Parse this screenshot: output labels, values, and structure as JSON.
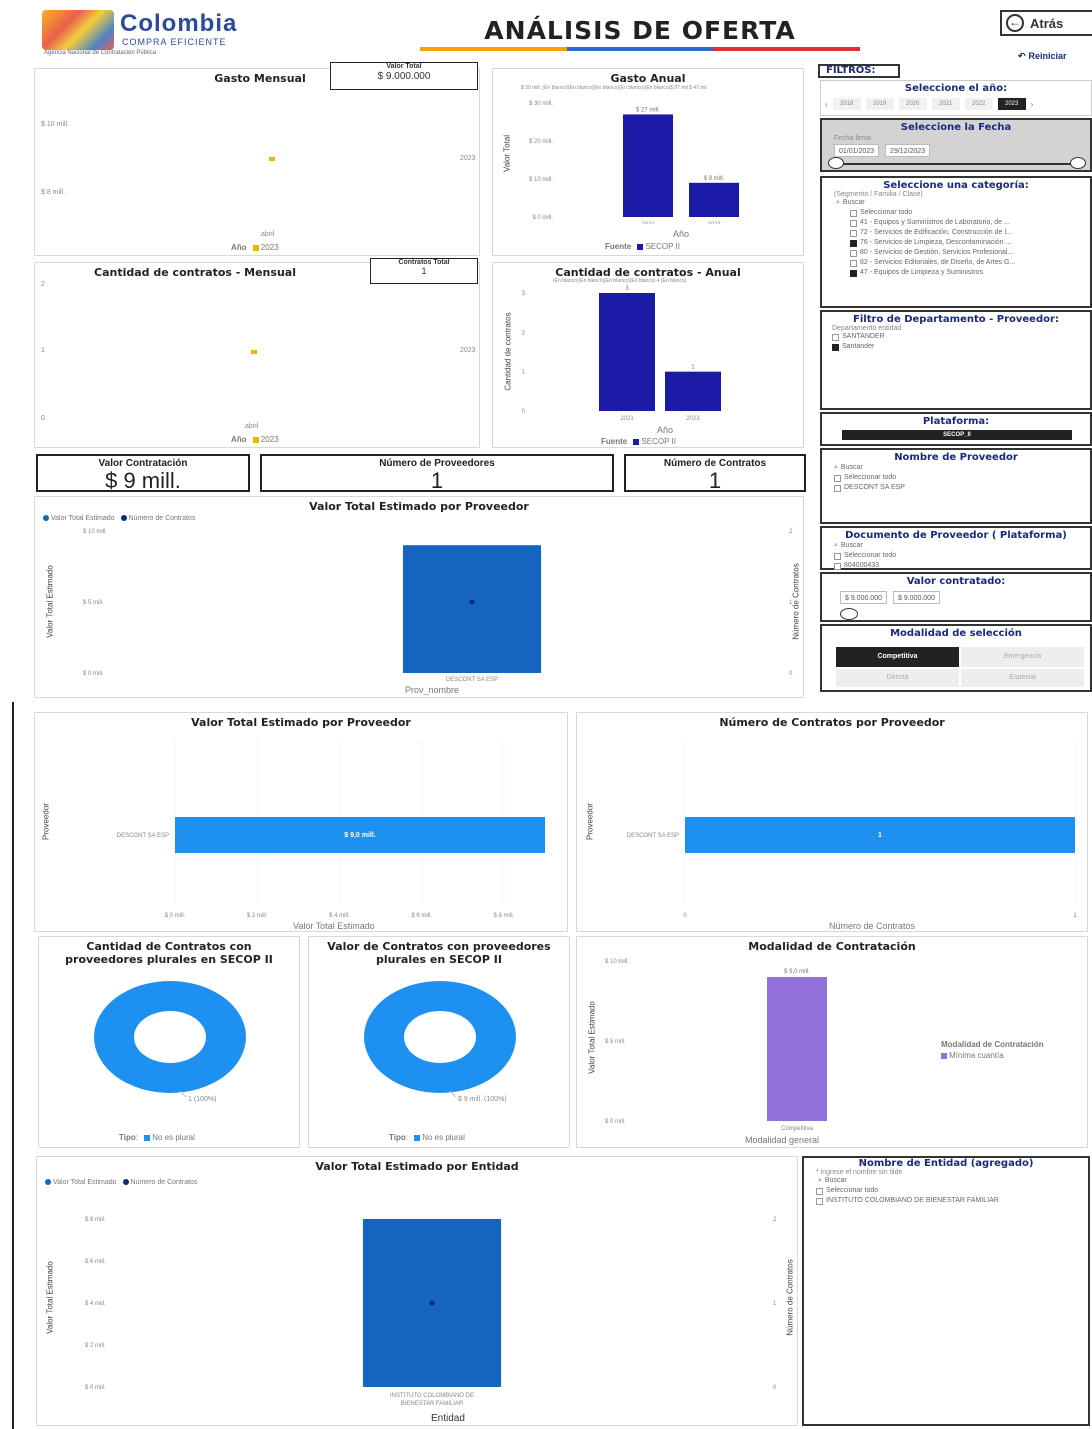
{
  "header": {
    "logo_name": "Colombia",
    "logo_sub": "COMPRA EFICIENTE",
    "logo_tag": "Agencia Nacional de Contratación Pública",
    "title": "ANÁLISIS DE OFERTA",
    "back_label": "Atrás",
    "reset_label": "Reiniciar"
  },
  "kpis": {
    "valor_total_label": "Valor Total",
    "valor_total": "$ 9.000.000",
    "contratos_total_label": "Contratos Total",
    "contratos_total": "1",
    "valor_contratacion_label": "Valor Contratación",
    "valor_contratacion": "$ 9 mill.",
    "num_proveedores_label": "Número de Proveedores",
    "num_proveedores": "1",
    "num_contratos_label": "Número de Contratos",
    "num_contratos": "1"
  },
  "gasto_mensual": {
    "title": "Gasto Mensual",
    "ticks": [
      "$ 10 mill.",
      "$ 8 mill."
    ],
    "right_label": "2023",
    "x_label": "abril",
    "legend_title": "Año",
    "legend_item": "2023",
    "color": "#e6b800"
  },
  "cantidad_mensual": {
    "title": "Cantidad de contratos - Mensual",
    "ticks": [
      "2",
      "1",
      "0"
    ],
    "right_label": "2023",
    "x_label": "abril",
    "legend_title": "Año",
    "legend_item": "2023",
    "color": "#e6b800"
  },
  "gasto_anual": {
    "title": "Gasto Anual",
    "top_note": "$ 30 mill.  (En blanco)(En blanco)(En blanco)(En blanco)(En blanco)$ 87 mil   $ 47 mil",
    "ylabel": "Valor Total",
    "xlabel": "Año",
    "legend_title": "Fuente",
    "legend_item": "SECOP II",
    "color": "#1a1aa6",
    "chart_data": {
      "type": "bar",
      "categories": [
        "2021",
        "2023"
      ],
      "values": [
        27,
        9
      ],
      "value_labels": [
        "$ 27 mill.",
        "$ 9 mill."
      ],
      "ticks": [
        "$ 30 mill.",
        "$ 20 mill.",
        "$ 10 mill.",
        "$ 0 mill."
      ],
      "ylim": [
        0,
        30
      ]
    }
  },
  "cantidad_anual": {
    "title": "Cantidad de contratos - Anual",
    "top_note": "(En blanco)(En blanco)(En blanco)(En blanco)     4      (En blanco)",
    "ylabel": "Cantidad de contratos",
    "xlabel": "Año",
    "legend_title": "Fuente",
    "legend_item": "SECOP II",
    "color": "#1a1aa6",
    "chart_data": {
      "type": "bar",
      "categories": [
        "2021",
        "2023"
      ],
      "values": [
        3,
        1
      ],
      "value_labels": [
        "3",
        "1"
      ],
      "ticks": [
        "3",
        "2",
        "1",
        "0"
      ],
      "ylim": [
        0,
        3
      ]
    }
  },
  "prov_combo": {
    "title": "Valor Total Estimado por Proveedor",
    "legend": [
      "Valor Total Estimado",
      "Número de Contratos"
    ],
    "left_ticks": [
      "$ 10 mill.",
      "$ 5 mill.",
      "$ 0 mill."
    ],
    "right_ticks": [
      "2",
      "1",
      "0"
    ],
    "ylabel": "Valor Total Estimado",
    "y2label": "Número de Contratos",
    "xlabel": "Prov_nombre",
    "category": "DESCONT SA ESP",
    "color": "#1565c0",
    "chart_data": {
      "type": "bar",
      "categories": [
        "DESCONT SA ESP"
      ],
      "values": [
        9
      ],
      "contracts": [
        1
      ],
      "ylim": [
        0,
        10
      ]
    }
  },
  "filters": {
    "title": "FILTROS:",
    "year_title": "Seleccione el año:",
    "years": [
      "2018",
      "2019",
      "2020",
      "2021",
      "2022",
      "2023"
    ],
    "date_title": "Seleccione la Fecha",
    "date_label": "Fecha firma",
    "date_from": "01/01/2023",
    "date_to": "29/12/2023",
    "cat_title": "Seleccione una categoría:",
    "cat_sub": "(Segmento / Familia / Clase)",
    "search": "Buscar",
    "cat_items": [
      {
        "label": "Seleccionar todo",
        "on": false
      },
      {
        "label": "41 - Equipos y Suministros de Laboratorio, de ...",
        "on": false
      },
      {
        "label": "72 - Servicios de Edificación, Construcción de I...",
        "on": false
      },
      {
        "label": "76 - Servicios de Limpieza, Descontaminación ...",
        "on": true
      },
      {
        "label": "80 - Servicios de Gestión, Servicios Profesional...",
        "on": false
      },
      {
        "label": "82 - Servicios Editoriales, de Diseño, de Artes G...",
        "on": false
      },
      {
        "label": "47 - Equipos de Limpieza y Suministros",
        "on": true
      }
    ],
    "dept_title": "Filtro de Departamento - Proveedor:",
    "dept_sub": "Departamento entidad",
    "dept_items": [
      {
        "label": "SANTANDER",
        "on": false
      },
      {
        "label": "Santander",
        "on": true
      }
    ],
    "plat_title": "Plataforma:",
    "plat_value": "SECOP_II",
    "prov_title": "Nombre de Proveedor",
    "prov_items": [
      {
        "label": "Seleccionar todo",
        "on": false
      },
      {
        "label": "DESCONT SA ESP",
        "on": false
      }
    ],
    "doc_title": "Documento de Proveedor ( Plataforma)",
    "doc_items": [
      {
        "label": "Seleccionar todo",
        "on": false
      },
      {
        "label": "804000433",
        "on": false
      }
    ],
    "valor_title": "Valor contratado:",
    "valor_from": "$ 9.000.000",
    "valor_to": "$ 9.000.000",
    "mod_title": "Modalidad de selección",
    "mod_buttons": [
      "Competitiva",
      "Emergencia",
      "Directa",
      "Especial"
    ]
  },
  "bar_valor_prov": {
    "title": "Valor Total Estimado por Proveedor",
    "ylabel": "Proveedor",
    "xlabel": "Valor Total Estimado",
    "category": "DESCONT SA ESP",
    "value_label": "$ 9,0 mill.",
    "ticks": [
      "$ 0 mill.",
      "$ 2 mill.",
      "$ 4 mill.",
      "$ 6 mill.",
      "$ 8 mill."
    ],
    "color": "#1e90f0",
    "chart_data": {
      "type": "bar",
      "categories": [
        "DESCONT SA ESP"
      ],
      "values": [
        9
      ],
      "xlim": [
        0,
        9
      ]
    }
  },
  "bar_num_prov": {
    "title": "Número de Contratos por Proveedor",
    "ylabel": "Proveedor",
    "xlabel": "Número de Contratos",
    "category": "DESCONT SA ESP",
    "value_label": "1",
    "ticks": [
      "0",
      "1"
    ],
    "color": "#1e90f0",
    "chart_data": {
      "type": "bar",
      "categories": [
        "DESCONT SA ESP"
      ],
      "values": [
        1
      ],
      "xlim": [
        0,
        1
      ]
    }
  },
  "donut_cant": {
    "title": "Cantidad de Contratos con proveedores plurales en SECOP II",
    "label": "1 (100%)",
    "legend_title": "Tipo",
    "legend_item": "No es plural",
    "color": "#1e90f0",
    "chart_data": {
      "type": "pie",
      "categories": [
        "No es plural"
      ],
      "values": [
        1
      ]
    }
  },
  "donut_valor": {
    "title": "Valor de Contratos con proveedores plurales en SECOP II",
    "label": "$ 9 mill. (100%)",
    "legend_title": "Tipo",
    "legend_item": "No es plural",
    "color": "#1e90f0",
    "chart_data": {
      "type": "pie",
      "categories": [
        "No es plural"
      ],
      "values": [
        9
      ]
    }
  },
  "modalidad": {
    "title": "Modalidad de Contratación",
    "ylabel": "Valor Total Estimado",
    "xlabel": "Modalidad general",
    "category": "Competitiva",
    "value_label": "$ 9,0 mill.",
    "ticks": [
      "$ 10 mill.",
      "$ 5 mill.",
      "$ 0 mill."
    ],
    "legend_title": "Modalidad de Contratación",
    "legend_item": "Mínima cuantía",
    "color": "#9370db",
    "chart_data": {
      "type": "bar",
      "categories": [
        "Competitiva"
      ],
      "values": [
        9
      ],
      "ylim": [
        0,
        10
      ]
    }
  },
  "entidad_combo": {
    "title": "Valor Total Estimado por Entidad",
    "legend": [
      "Valor Total Estimado",
      "Número de Contratos"
    ],
    "left_ticks": [
      "$ 8 mill.",
      "$ 6 mill.",
      "$ 4 mill.",
      "$ 2 mill.",
      "$ 0 mill."
    ],
    "right_ticks": [
      "2",
      "1",
      "0"
    ],
    "ylabel": "Valor Total Estimado",
    "y2label": "Número de Contratos",
    "xlabel": "Entidad",
    "category_l1": "INSTITUTO COLOMBIANO DE",
    "category_l2": "BIENESTAR FAMILIAR",
    "color": "#1565c0",
    "chart_data": {
      "type": "bar",
      "categories": [
        "INSTITUTO COLOMBIANO DE BIENESTAR FAMILIAR"
      ],
      "values": [
        9
      ],
      "contracts": [
        1
      ],
      "ylim": [
        0,
        9
      ]
    }
  },
  "entidad_filter": {
    "title": "Nombre de Entidad (agregado)",
    "hint": "* ingrese el nombre sin tilde",
    "search": "Buscar",
    "items": [
      {
        "label": "Seleccionar todo",
        "on": false
      },
      {
        "label": "INSTITUTO COLOMBIANO DE BIENESTAR FAMILIAR",
        "on": false
      }
    ]
  }
}
